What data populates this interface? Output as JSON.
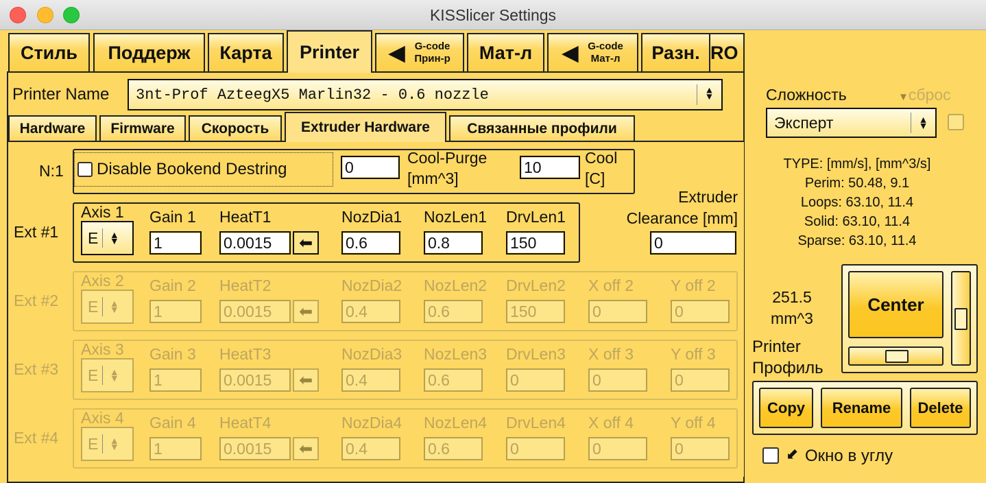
{
  "window": {
    "title": "KISSlicer Settings"
  },
  "main_tabs": [
    {
      "label": "Стиль"
    },
    {
      "label": "Поддерж"
    },
    {
      "label": "Карта"
    },
    {
      "label": "Printer",
      "active": true
    },
    {
      "line1": "G-code",
      "line2": "Прин-р",
      "arrow": "left-triangle-icon"
    },
    {
      "label": "Мат-л"
    },
    {
      "line1": "G-code",
      "line2": "Мат-л",
      "arrow": "left-triangle-icon"
    },
    {
      "label": "Разн."
    },
    {
      "label": "RO"
    }
  ],
  "printer": {
    "name_label": "Printer Name",
    "name_value": "3nt-Prof AzteegX5 Marlin32 - 0.6 nozzle"
  },
  "sub_tabs": [
    {
      "label": "Hardware"
    },
    {
      "label": "Firmware"
    },
    {
      "label": "Скорость"
    },
    {
      "label": "Extruder Hardware",
      "active": true
    },
    {
      "label": "Связанные профили"
    }
  ],
  "top_row": {
    "n_label": "N:1",
    "disable_bookend_label": "Disable Bookend Destring",
    "disable_bookend_checked": false,
    "n_value": "0",
    "cool_purge_label_1": "Cool-Purge",
    "cool_purge_label_2": "[mm^3]",
    "cool_purge_value": "10",
    "cool_label_1": "Cool",
    "cool_label_2": "[C]"
  },
  "clearance": {
    "label_1": "Extruder",
    "label_2": "Clearance [mm]",
    "value": "0"
  },
  "extruders": [
    {
      "label": "Ext #1",
      "axis_label": "Axis 1",
      "axis": "E",
      "gain_label": "Gain 1",
      "gain": "1",
      "heat_label": "HeatT1",
      "heat": "0.0015",
      "noz_dia_label": "NozDia1",
      "noz_dia": "0.6",
      "noz_len_label": "NozLen1",
      "noz_len": "0.8",
      "drv_len_label": "DrvLen1",
      "drv_len": "150",
      "enabled": true
    },
    {
      "label": "Ext #2",
      "axis_label": "Axis 2",
      "axis": "E",
      "gain_label": "Gain 2",
      "gain": "1",
      "heat_label": "HeatT2",
      "heat": "0.0015",
      "noz_dia_label": "NozDia2",
      "noz_dia": "0.4",
      "noz_len_label": "NozLen2",
      "noz_len": "0.6",
      "drv_len_label": "DrvLen2",
      "drv_len": "150",
      "xoff_label": "X off 2",
      "xoff": "0",
      "yoff_label": "Y off 2",
      "yoff": "0",
      "enabled": false
    },
    {
      "label": "Ext #3",
      "axis_label": "Axis 3",
      "axis": "E",
      "gain_label": "Gain 3",
      "gain": "1",
      "heat_label": "HeatT3",
      "heat": "0.0015",
      "noz_dia_label": "NozDia3",
      "noz_dia": "0.4",
      "noz_len_label": "NozLen3",
      "noz_len": "0.6",
      "drv_len_label": "DrvLen3",
      "drv_len": "0",
      "xoff_label": "X off 3",
      "xoff": "0",
      "yoff_label": "Y off 3",
      "yoff": "0",
      "enabled": false
    },
    {
      "label": "Ext #4",
      "axis_label": "Axis 4",
      "axis": "E",
      "gain_label": "Gain 4",
      "gain": "1",
      "heat_label": "HeatT4",
      "heat": "0.0015",
      "noz_dia_label": "NozDia4",
      "noz_dia": "0.4",
      "noz_len_label": "NozLen4",
      "noz_len": "0.6",
      "drv_len_label": "DrvLen4",
      "drv_len": "0",
      "xoff_label": "X off 4",
      "xoff": "0",
      "yoff_label": "Y off 4",
      "yoff": "0",
      "enabled": false
    }
  ],
  "side": {
    "complexity_label": "Сложность",
    "reset_label": "сброс",
    "complexity_value": "Эксперт",
    "stats": [
      "TYPE: [mm/s], [mm^3/s]",
      "Perim:   50.48,  9.1",
      "Loops:   63.10,  11.4",
      "Solid:   63.10,  11.4",
      "Sparse:  63.10,  11.4"
    ],
    "volume": "251.5",
    "volume_unit": "mm^3",
    "profile_label_1": "Printer",
    "profile_label_2": "Профиль",
    "center_label": "Center",
    "copy_label": "Copy",
    "rename_label": "Rename",
    "delete_label": "Delete",
    "corner_window_label": "Окно в углу",
    "corner_window_checked": false
  },
  "colors": {
    "background": "#fdd863",
    "button": "#fcc92a",
    "disabled_text": "#bda65e"
  }
}
